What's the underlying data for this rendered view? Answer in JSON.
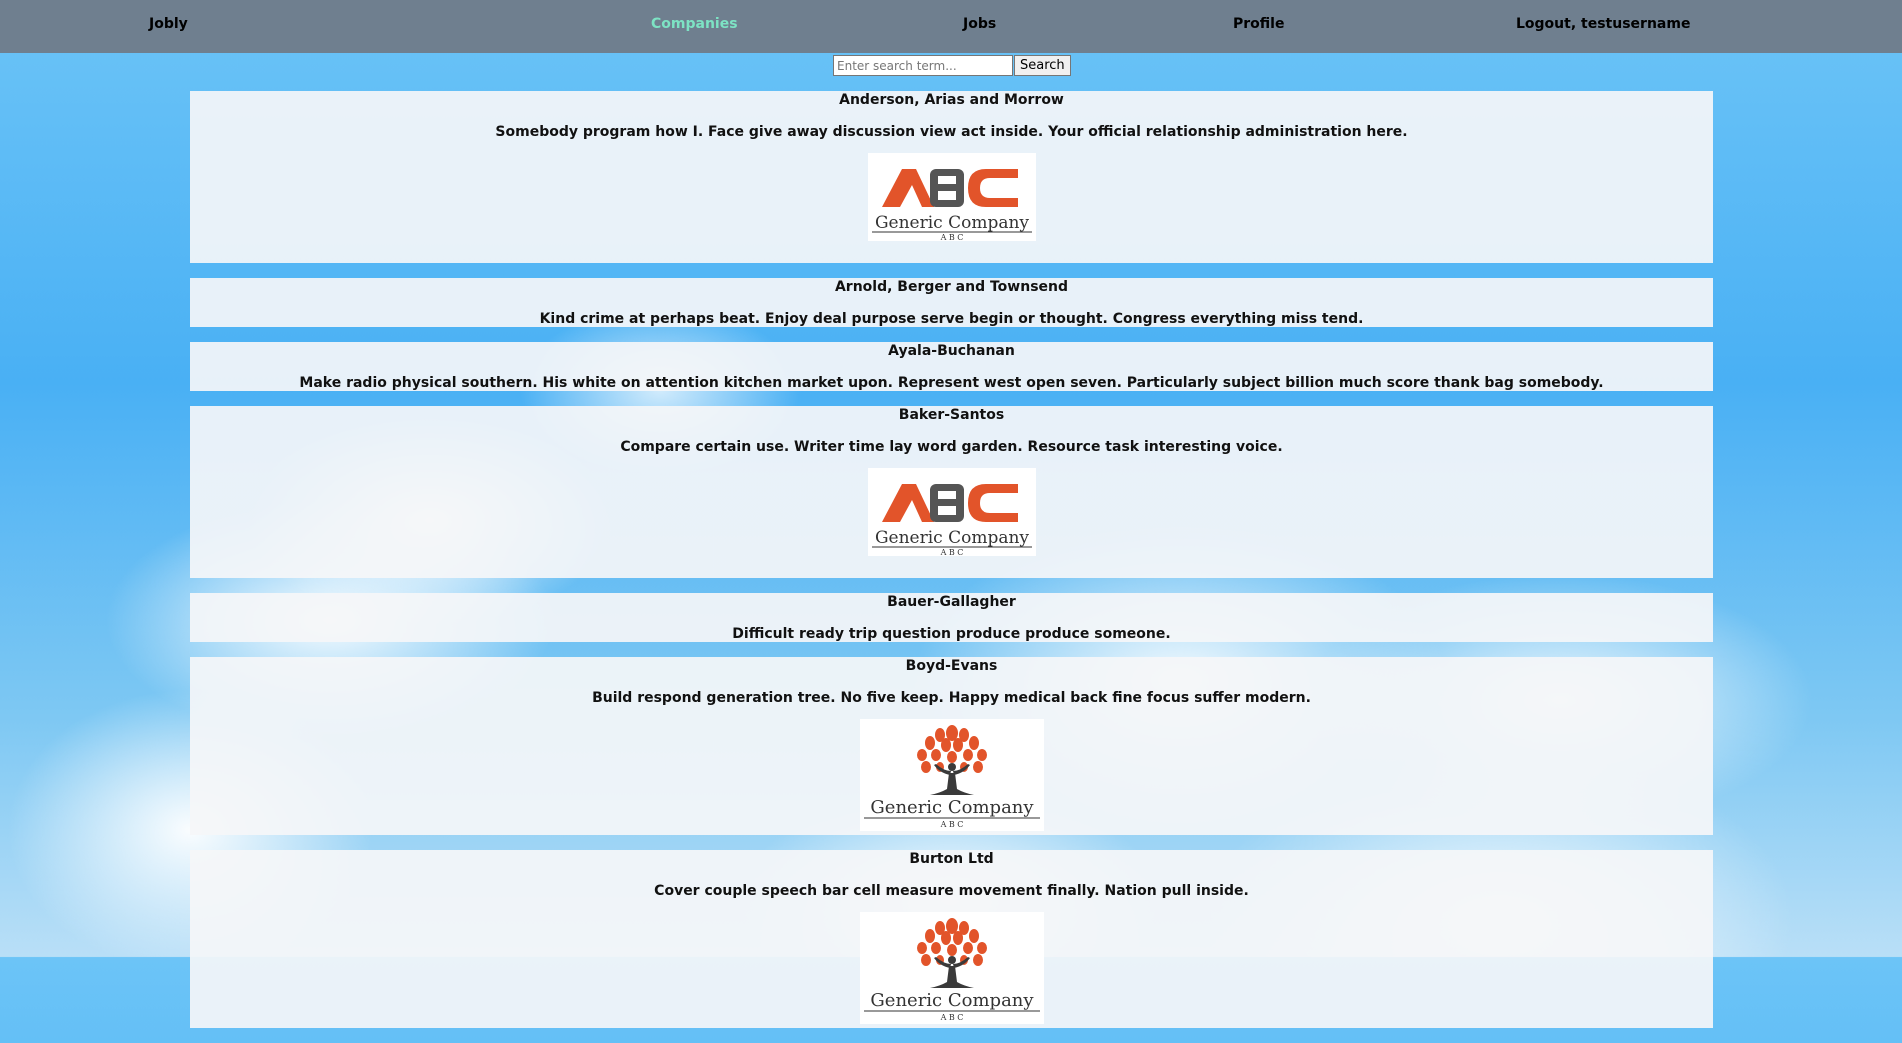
{
  "nav": {
    "brand": "Jobly",
    "companies": "Companies",
    "jobs": "Jobs",
    "profile": "Profile",
    "logout": "Logout, testusername"
  },
  "search": {
    "placeholder": "Enter search term...",
    "button": "Search"
  },
  "logo_text": {
    "abc_letters": "ABC",
    "company": "Generic Company",
    "tagline": "A B C"
  },
  "companies": [
    {
      "name": "Anderson, Arias and Morrow",
      "description": "Somebody program how I. Face give away discussion view act inside. Your official relationship administration here.",
      "logo": "abc-logo"
    },
    {
      "name": "Arnold, Berger and Townsend",
      "description": "Kind crime at perhaps beat. Enjoy deal purpose serve begin or thought. Congress everything miss tend.",
      "logo": null
    },
    {
      "name": "Ayala-Buchanan",
      "description": "Make radio physical southern. His white on attention kitchen market upon. Represent west open seven. Particularly subject billion much score thank bag somebody.",
      "logo": null
    },
    {
      "name": "Baker-Santos",
      "description": "Compare certain use. Writer time lay word garden. Resource task interesting voice.",
      "logo": "abc-logo"
    },
    {
      "name": "Bauer-Gallagher",
      "description": "Difficult ready trip question produce produce someone.",
      "logo": null
    },
    {
      "name": "Boyd-Evans",
      "description": "Build respond generation tree. No five keep. Happy medical back fine focus suffer modern.",
      "logo": "tree-logo"
    },
    {
      "name": "Burton Ltd",
      "description": "Cover couple speech bar cell measure movement finally. Nation pull inside.",
      "logo": "tree-logo"
    }
  ],
  "colors": {
    "nav_bg": "#6f7f8f",
    "active_link": "#7de3c4",
    "logo_orange": "#e2542a",
    "logo_gray": "#555555"
  }
}
